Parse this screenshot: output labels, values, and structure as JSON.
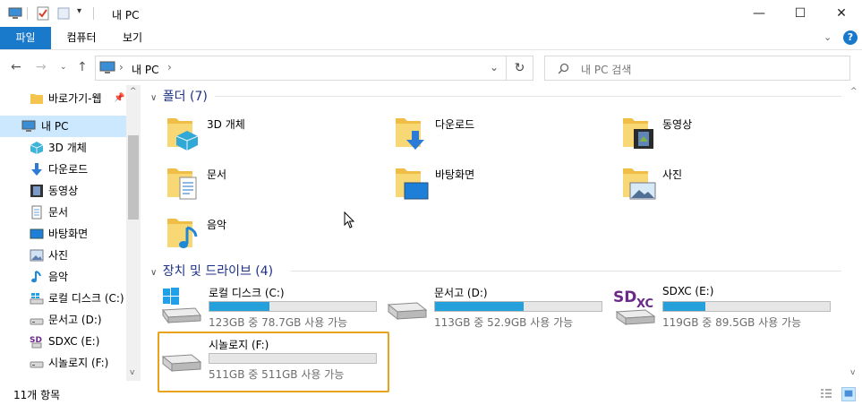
{
  "window": {
    "title": "내 PC",
    "minimize_glyph": "—",
    "maximize_glyph": "☐",
    "close_glyph": "✕"
  },
  "ribbon": {
    "tabs": [
      {
        "label": "파일"
      },
      {
        "label": "컴퓨터"
      },
      {
        "label": "보기"
      }
    ],
    "help_glyph": "?"
  },
  "address": {
    "breadcrumb": [
      "내 PC"
    ],
    "search_placeholder": "내 PC 검색"
  },
  "sidebar": {
    "items": [
      {
        "label": "바로가기-웹",
        "icon": "folder-icon"
      },
      {
        "label": "내 PC",
        "icon": "computer-icon",
        "selected": true
      },
      {
        "label": "3D 개체",
        "icon": "cube-icon"
      },
      {
        "label": "다운로드",
        "icon": "download-icon"
      },
      {
        "label": "동영상",
        "icon": "film-icon"
      },
      {
        "label": "문서",
        "icon": "document-icon"
      },
      {
        "label": "바탕화면",
        "icon": "desktop-icon"
      },
      {
        "label": "사진",
        "icon": "picture-icon"
      },
      {
        "label": "음악",
        "icon": "music-icon"
      },
      {
        "label": "로컬 디스크 (C:)",
        "icon": "windows-drive-icon"
      },
      {
        "label": "문서고 (D:)",
        "icon": "drive-icon"
      },
      {
        "label": "SDXC (E:)",
        "icon": "sdxc-icon"
      },
      {
        "label": "시놀로지 (F:)",
        "icon": "drive-icon"
      }
    ]
  },
  "folders": {
    "header": "폴더 (7)",
    "items": [
      {
        "label": "3D 개체",
        "overlay": "cube"
      },
      {
        "label": "다운로드",
        "overlay": "download"
      },
      {
        "label": "동영상",
        "overlay": "film"
      },
      {
        "label": "문서",
        "overlay": "document"
      },
      {
        "label": "바탕화면",
        "overlay": "desktop"
      },
      {
        "label": "사진",
        "overlay": "picture"
      },
      {
        "label": "음악",
        "overlay": "music"
      }
    ]
  },
  "drives": {
    "header": "장치 및 드라이브 (4)",
    "items": [
      {
        "name": "로컬 디스크 (C:)",
        "space": "123GB 중 78.7GB 사용 가능",
        "used_fraction": 0.36,
        "icon": "windows-drive-icon"
      },
      {
        "name": "문서고 (D:)",
        "space": "113GB 중 52.9GB 사용 가능",
        "used_fraction": 0.53,
        "icon": "drive-icon"
      },
      {
        "name": "SDXC (E:)",
        "space": "119GB 중 89.5GB 사용 가능",
        "used_fraction": 0.25,
        "icon": "sdxc-icon"
      },
      {
        "name": "시놀로지 (F:)",
        "space": "511GB 중 511GB 사용 가능",
        "used_fraction": 0.0,
        "icon": "drive-icon",
        "highlighted": true
      }
    ],
    "highlight_color": "#e8a21c"
  },
  "status": {
    "count": "11개 항목"
  },
  "colors": {
    "accent": "#1979ca",
    "bar_fill": "#26a0da",
    "header_text": "#1e3287",
    "selected_bg": "#cce8ff"
  }
}
